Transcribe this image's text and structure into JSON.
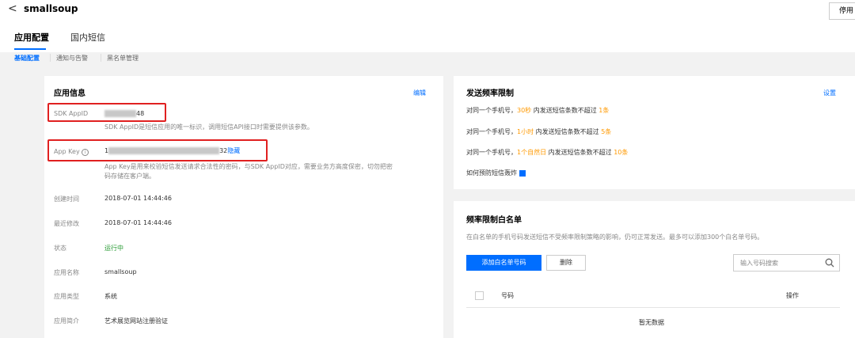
{
  "header": {
    "back_glyph": "<",
    "app_name": "smallsoup",
    "stop_button": "停用"
  },
  "tabs": [
    {
      "label": "应用配置",
      "active": true
    },
    {
      "label": "国内短信",
      "active": false
    }
  ],
  "subnav": [
    {
      "label": "基础配置",
      "active": true
    },
    {
      "label": "通知与告警",
      "active": false
    },
    {
      "label": "黑名单管理",
      "active": false
    }
  ],
  "app_info": {
    "title": "应用信息",
    "edit_link": "编辑",
    "sdk_appid_label": "SDK AppID",
    "sdk_appid_prefix": "",
    "sdk_appid_suffix": "48",
    "sdk_appid_desc": "SDK AppID是短信应用的唯一标识，调用短信API接口时需要提供该参数。",
    "appkey_label": "App Key",
    "appkey_prefix": "1",
    "appkey_suffix": "32",
    "appkey_hide_link": "隐藏",
    "appkey_desc_line1": "App Key是用来校验短信发送请求合法性的密码，与SDK AppID对应，需要业务方高度保密，切勿把密",
    "appkey_desc_line2": "码存储在客户端。",
    "rows": [
      {
        "label": "创建时间",
        "value": "2018-07-01 14:44:46"
      },
      {
        "label": "最近修改",
        "value": "2018-07-01 14:44:46"
      },
      {
        "label": "状态",
        "value": "运行中"
      },
      {
        "label": "应用名称",
        "value": "smallsoup"
      },
      {
        "label": "应用类型",
        "value": "系统"
      },
      {
        "label": "应用简介",
        "value": "艺术展览网站注册验证"
      }
    ]
  },
  "freq_limit": {
    "title": "发送频率限制",
    "settings_link": "设置",
    "rules": [
      {
        "prefix": "对同一个手机号，",
        "period": "30秒",
        "middle": "内发送短信条数不超过",
        "count": "1条"
      },
      {
        "prefix": "对同一个手机号，",
        "period": "1小时",
        "middle": "内发送短信条数不超过",
        "count": "5条"
      },
      {
        "prefix": "对同一个手机号，",
        "period": "1个自然日",
        "middle": "内发送短信条数不超过",
        "count": "10条"
      }
    ],
    "help_link": "如何预防短信轰炸"
  },
  "whitelist": {
    "title": "频率限制白名单",
    "desc": "在白名单的手机号码发送短信不受频率限制策略的影响，仍可正常发送。最多可以添加300个白名单号码。",
    "add_button": "添加白名单号码",
    "delete_button": "删除",
    "search_placeholder": "输入号码搜索",
    "col_number": "号码",
    "col_action": "操作",
    "empty_text": "暂无数据"
  },
  "colors": {
    "accent": "#006eff",
    "status_green": "#2a9b35",
    "highlight_orange": "#ff9900",
    "annotation_red": "#e02020"
  }
}
